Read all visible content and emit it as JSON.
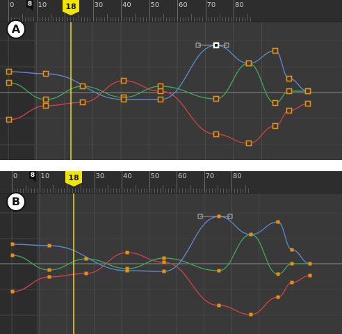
{
  "ruler": {
    "tick_labels": [
      "0",
      "10",
      "20",
      "30",
      "40",
      "50",
      "60",
      "70",
      "80"
    ],
    "start_frame": "8",
    "playhead_frame": "18"
  },
  "panels": [
    {
      "id": "A",
      "label": "A"
    },
    {
      "id": "B",
      "label": "B"
    }
  ],
  "colors": {
    "background": "#393939",
    "ruler": "#2d2d2d",
    "curve_blue": "#5b86c8",
    "curve_green": "#3ea357",
    "curve_red": "#c8404a",
    "key_fill": "#e8900f",
    "playhead": "#f2e600"
  },
  "icons": {
    "label_circle": "circled-letter-icon",
    "playhead": "playhead-flag-icon",
    "start_marker": "start-frame-marker-icon",
    "key": "square-keyframe-icon",
    "tangent_handle": "tangent-handle-icon"
  }
}
